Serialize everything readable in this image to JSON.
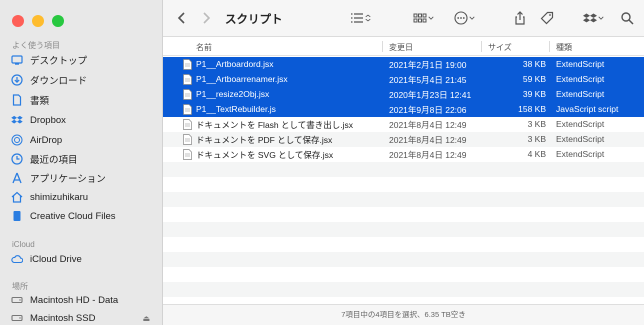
{
  "window": {
    "title": "スクリプト"
  },
  "sidebar": {
    "favorites_header": "よく使う項目",
    "favorites": [
      {
        "label": "デスクトップ",
        "icon": "desktop-icon"
      },
      {
        "label": "ダウンロード",
        "icon": "download-icon"
      },
      {
        "label": "書類",
        "icon": "document-icon"
      },
      {
        "label": "Dropbox",
        "icon": "dropbox-icon"
      },
      {
        "label": "AirDrop",
        "icon": "airdrop-icon"
      },
      {
        "label": "最近の項目",
        "icon": "clock-icon"
      },
      {
        "label": "アプリケーション",
        "icon": "applications-icon"
      },
      {
        "label": "shimizuhikaru",
        "icon": "home-icon"
      },
      {
        "label": "Creative Cloud Files",
        "icon": "file-icon"
      }
    ],
    "icloud_header": "iCloud",
    "icloud": [
      {
        "label": "iCloud Drive",
        "icon": "cloud-icon"
      }
    ],
    "locations_header": "場所",
    "locations": [
      {
        "label": "Macintosh HD - Data",
        "icon": "disk-icon"
      },
      {
        "label": "Macintosh SSD",
        "icon": "disk-icon",
        "eject": "⏏"
      }
    ]
  },
  "columns": {
    "name": "名前",
    "date": "変更日",
    "size": "サイズ",
    "kind": "種類"
  },
  "files": [
    {
      "name": "P1__Artboardord.jsx",
      "date": "2021年2月1日 19:00",
      "size": "38 KB",
      "kind": "ExtendScript",
      "selected": true
    },
    {
      "name": "P1__Artboarrenamer.jsx",
      "date": "2021年5月4日 21:45",
      "size": "59 KB",
      "kind": "ExtendScript",
      "selected": true
    },
    {
      "name": "P1__resize2Obj.jsx",
      "date": "2020年1月23日 12:41",
      "size": "39 KB",
      "kind": "ExtendScript",
      "selected": true
    },
    {
      "name": "P1__TextRebuilder.js",
      "date": "2021年9月8日 22:06",
      "size": "158 KB",
      "kind": "JavaScript script",
      "selected": true
    },
    {
      "name": "ドキュメントを Flash として書き出し.jsx",
      "date": "2021年8月4日 12:49",
      "size": "3 KB",
      "kind": "ExtendScript",
      "selected": false
    },
    {
      "name": "ドキュメントを PDF として保存.jsx",
      "date": "2021年8月4日 12:49",
      "size": "3 KB",
      "kind": "ExtendScript",
      "selected": false
    },
    {
      "name": "ドキュメントを SVG として保存.jsx",
      "date": "2021年8月4日 12:49",
      "size": "4 KB",
      "kind": "ExtendScript",
      "selected": false
    }
  ],
  "status_text": "7項目中の4項目を選択、6.35 TB空き",
  "colors": {
    "selection": "#0a5ad6",
    "sidebar_bg": "#e8e8e8"
  }
}
